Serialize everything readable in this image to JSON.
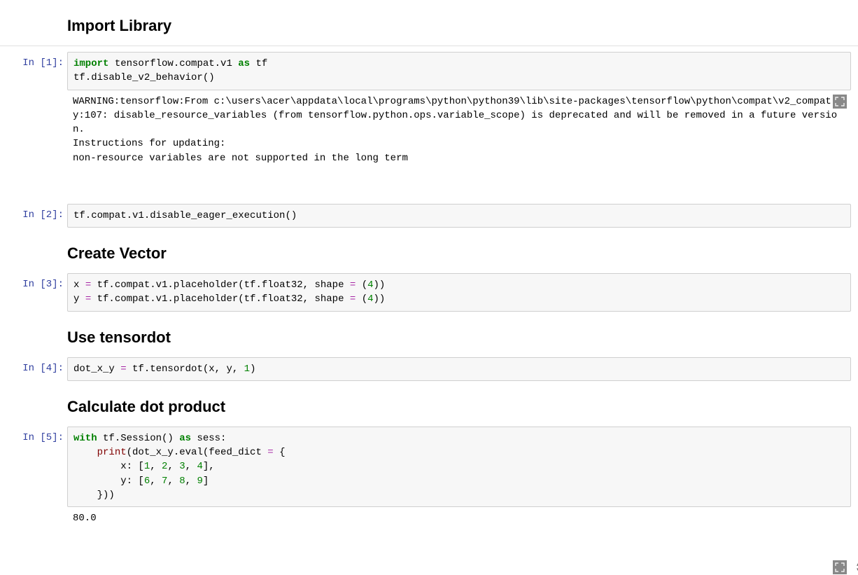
{
  "headings": {
    "import": "Import Library",
    "create_vec": "Create Vector",
    "use_td": "Use tensordot",
    "calc": "Calculate dot product"
  },
  "prompts": {
    "in1": "In [1]:",
    "in2": "In [2]:",
    "in3": "In [3]:",
    "in4": "In [4]:",
    "in5": "In [5]:"
  },
  "code1": {
    "kw_import": "import",
    "mod": " tensorflow.compat.v1 ",
    "kw_as": "as",
    "alias": " tf",
    "line2": "tf.disable_v2_behavior()"
  },
  "out1": "WARNING:tensorflow:From c:\\users\\acer\\appdata\\local\\programs\\python\\python39\\lib\\site-packages\\tensorflow\\python\\compat\\v2_compat.py:107: disable_resource_variables (from tensorflow.python.ops.variable_scope) is deprecated and will be removed in a future version.\nInstructions for updating:\nnon-resource variables are not supported in the long term",
  "code2": "tf.compat.v1.disable_eager_execution()",
  "code3": {
    "l1a": "x ",
    "l1eq": "=",
    "l1b": " tf.compat.v1.placeholder(tf.float32, shape ",
    "l1eq2": "=",
    "l1c": " (",
    "l1n": "4",
    "l1d": "))",
    "l2a": "y ",
    "l2eq": "=",
    "l2b": " tf.compat.v1.placeholder(tf.float32, shape ",
    "l2eq2": "=",
    "l2c": " (",
    "l2n": "4",
    "l2d": "))"
  },
  "code4": {
    "a": "dot_x_y ",
    "eq": "=",
    "b": " tf.tensordot(x, y, ",
    "n": "1",
    "c": ")"
  },
  "code5": {
    "l1_with": "with",
    "l1_a": " tf.Session() ",
    "l1_as": "as",
    "l1_b": " sess:",
    "l2_pad": "    ",
    "l2_print": "print",
    "l2_a": "(dot_x_y.eval(feed_dict ",
    "l2_eq": "=",
    "l2_b": " {",
    "l3_pad": "        x: [",
    "l3_n1": "1",
    "l3_c1": ", ",
    "l3_n2": "2",
    "l3_c2": ", ",
    "l3_n3": "3",
    "l3_c3": ", ",
    "l3_n4": "4",
    "l3_end": "],",
    "l4_pad": "        y: [",
    "l4_n1": "6",
    "l4_c1": ", ",
    "l4_n2": "7",
    "l4_c2": ", ",
    "l4_n3": "8",
    "l4_c3": ", ",
    "l4_n4": "9",
    "l4_end": "]",
    "l5": "    }))"
  },
  "out5": "80.0"
}
